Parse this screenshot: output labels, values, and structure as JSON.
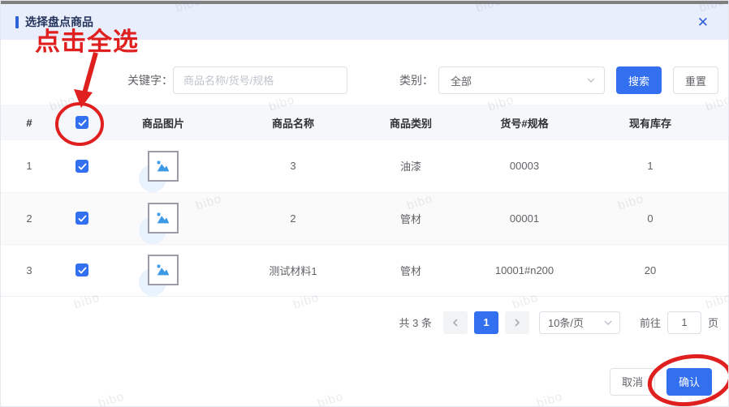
{
  "dialog": {
    "title": "选择盘点商品",
    "close_icon": "✕"
  },
  "annotation": {
    "select_all_note": "点击全选"
  },
  "watermark": {
    "text": "bibo"
  },
  "filters": {
    "keyword_label": "关键字：",
    "keyword_placeholder": "商品名称/货号/规格",
    "category_label": "类别：",
    "category_value": "全部",
    "search_button": "搜索",
    "reset_button": "重置"
  },
  "table": {
    "headers": {
      "index": "#",
      "image": "商品图片",
      "name": "商品名称",
      "category": "商品类别",
      "sku": "货号#规格",
      "stock": "现有库存"
    },
    "select_all_checked": true,
    "rows": [
      {
        "index": "1",
        "checked": true,
        "name": "3",
        "category": "油漆",
        "sku": "00003",
        "stock": "1"
      },
      {
        "index": "2",
        "checked": true,
        "name": "2",
        "category": "管材",
        "sku": "00001",
        "stock": "0"
      },
      {
        "index": "3",
        "checked": true,
        "name": "测试材料1",
        "category": "管材",
        "sku": "10001#n200",
        "stock": "20"
      }
    ]
  },
  "pagination": {
    "total": "共 3 条",
    "current_page": "1",
    "page_size": "10条/页",
    "goto_label": "前往",
    "goto_value": "1",
    "goto_suffix": "页"
  },
  "footer": {
    "cancel_button": "取消",
    "confirm_button": "确认"
  },
  "colors": {
    "primary": "#3370f0",
    "annotation_red": "#e01f1f",
    "header_bg": "#e9eefc"
  }
}
